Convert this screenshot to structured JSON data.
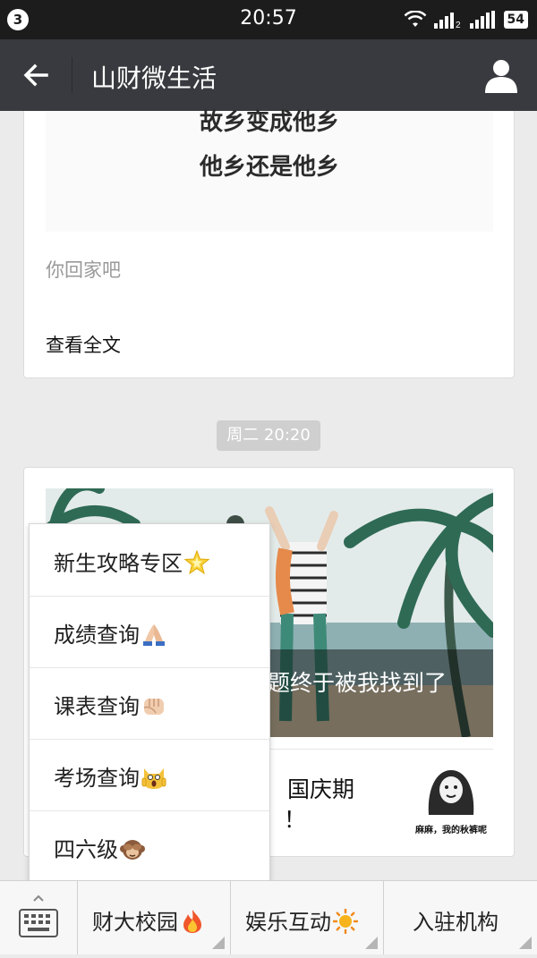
{
  "status_bar": {
    "notification_count": "3",
    "time": "20:57",
    "battery": "54",
    "icons": [
      "wifi-icon",
      "signal-icon",
      "signal-icon",
      "battery-icon"
    ]
  },
  "header": {
    "title": "山财微生活",
    "back_icon": "arrow-left-icon",
    "profile_icon": "user-icon",
    "colors": {
      "background": "#393a3f",
      "text": "#ffffff"
    }
  },
  "article1": {
    "image_lines": [
      "故乡变成他乡",
      "他乡还是他乡"
    ],
    "digest": "你回家吧",
    "read_more": "查看全文"
  },
  "timestamp": "周二 20:20",
  "article2": {
    "caption": "题终于被我找到了",
    "sub_title_line1": "国庆期",
    "sub_title_line2": "！",
    "thumb_caption": "麻麻，我的秋裤呢"
  },
  "menu": {
    "items": [
      {
        "label": "新生攻略专区",
        "emoji": "glowing-star-icon"
      },
      {
        "label": "成绩查询",
        "emoji": "folded-hands-icon"
      },
      {
        "label": "课表查询",
        "emoji": "fist-icon"
      },
      {
        "label": "考场查询",
        "emoji": "screaming-cat-icon"
      },
      {
        "label": "四六级",
        "emoji": "see-no-evil-monkey-icon"
      }
    ]
  },
  "bottom_bar": {
    "keyboard_icon": "keyboard-icon",
    "tabs": [
      {
        "label": "财大校园",
        "emoji": "fire-icon"
      },
      {
        "label": "娱乐互动",
        "emoji": "sun-icon"
      },
      {
        "label": "入驻机构",
        "emoji": ""
      }
    ]
  },
  "colors": {
    "accent": "#393a3f",
    "page_bg": "#ebebeb"
  }
}
